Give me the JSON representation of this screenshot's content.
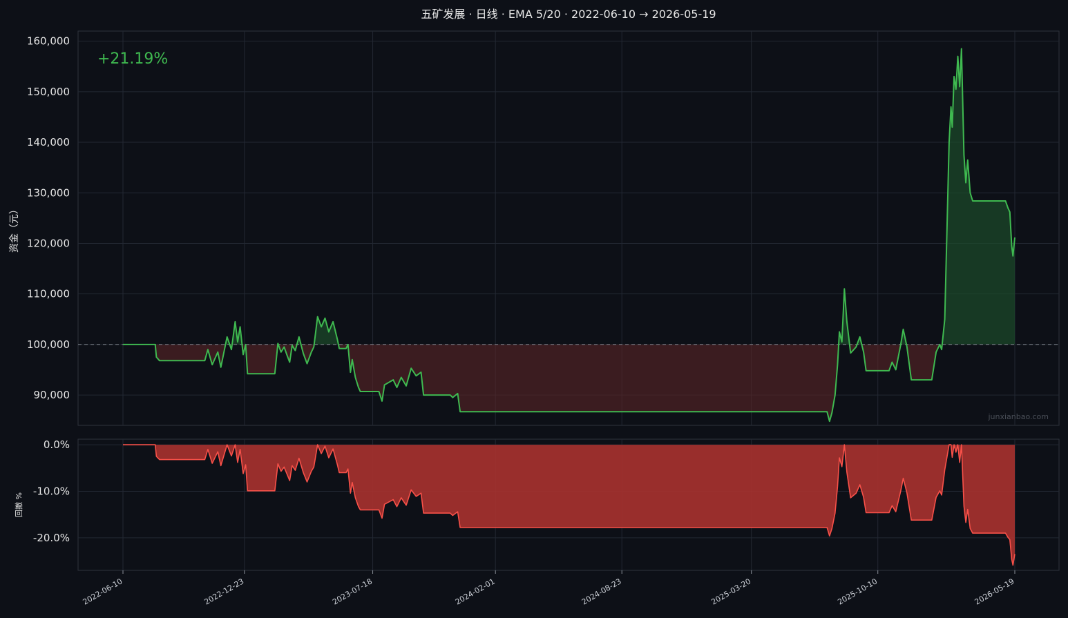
{
  "chart_data": [
    {
      "type": "line",
      "title": "五矿发展 · 日线 · EMA 5/20 · 2022-06-10 → 2026-05-19",
      "ylabel": "资金（元）",
      "ylim": [
        84000,
        162000
      ],
      "yticks": [
        "90,000",
        "100,000",
        "110,000",
        "120,000",
        "130,000",
        "140,000",
        "150,000",
        "160,000"
      ],
      "ytick_values": [
        90000,
        100000,
        110000,
        120000,
        130000,
        140000,
        150000,
        160000
      ],
      "baseline": 100000,
      "return_label": "+21.19%",
      "watermark": "junxianbao.com",
      "series": [
        {
          "color": "#3fb950",
          "points": [
            [
              "2022-06-10",
              100000
            ],
            [
              "2022-08-01",
              100000
            ],
            [
              "2022-08-03",
              97500
            ],
            [
              "2022-08-08",
              96800
            ],
            [
              "2022-10-20",
              96800
            ],
            [
              "2022-10-25",
              99000
            ],
            [
              "2022-11-01",
              96000
            ],
            [
              "2022-11-10",
              98500
            ],
            [
              "2022-11-15",
              95500
            ],
            [
              "2022-11-25",
              101500
            ],
            [
              "2022-12-02",
              99000
            ],
            [
              "2022-12-08",
              104500
            ],
            [
              "2022-12-12",
              100500
            ],
            [
              "2022-12-16",
              103500
            ],
            [
              "2022-12-21",
              98000
            ],
            [
              "2022-12-25",
              100000
            ],
            [
              "2022-12-28",
              94200
            ],
            [
              "2023-02-10",
              94200
            ],
            [
              "2023-02-15",
              100200
            ],
            [
              "2023-02-20",
              98500
            ],
            [
              "2023-02-25",
              99500
            ],
            [
              "2023-03-02",
              97800
            ],
            [
              "2023-03-06",
              96500
            ],
            [
              "2023-03-10",
              99800
            ],
            [
              "2023-03-15",
              98800
            ],
            [
              "2023-03-21",
              101500
            ],
            [
              "2023-03-28",
              98200
            ],
            [
              "2023-04-03",
              96200
            ],
            [
              "2023-04-10",
              98500
            ],
            [
              "2023-04-14",
              99500
            ],
            [
              "2023-04-20",
              105500
            ],
            [
              "2023-04-26",
              103500
            ],
            [
              "2023-05-02",
              105200
            ],
            [
              "2023-05-08",
              102500
            ],
            [
              "2023-05-15",
              104500
            ],
            [
              "2023-05-22",
              101000
            ],
            [
              "2023-05-25",
              99200
            ],
            [
              "2023-06-05",
              99200
            ],
            [
              "2023-06-08",
              100000
            ],
            [
              "2023-06-12",
              94500
            ],
            [
              "2023-06-15",
              97000
            ],
            [
              "2023-06-20",
              93500
            ],
            [
              "2023-06-25",
              91500
            ],
            [
              "2023-06-28",
              90700
            ],
            [
              "2023-07-28",
              90700
            ],
            [
              "2023-08-02",
              88800
            ],
            [
              "2023-08-06",
              92000
            ],
            [
              "2023-08-20",
              93000
            ],
            [
              "2023-08-26",
              91500
            ],
            [
              "2023-09-02",
              93500
            ],
            [
              "2023-09-10",
              91800
            ],
            [
              "2023-09-18",
              95300
            ],
            [
              "2023-09-26",
              93800
            ],
            [
              "2023-10-04",
              94500
            ],
            [
              "2023-10-08",
              90000
            ],
            [
              "2023-11-20",
              90000
            ],
            [
              "2023-11-24",
              89500
            ],
            [
              "2023-12-02",
              90300
            ],
            [
              "2023-12-06",
              86700
            ],
            [
              "2025-07-20",
              86700
            ],
            [
              "2025-07-24",
              84800
            ],
            [
              "2025-07-28",
              86500
            ],
            [
              "2025-08-02",
              90000
            ],
            [
              "2025-08-06",
              96000
            ],
            [
              "2025-08-09",
              102500
            ],
            [
              "2025-08-13",
              100500
            ],
            [
              "2025-08-17",
              111000
            ],
            [
              "2025-08-21",
              104500
            ],
            [
              "2025-08-27",
              98300
            ],
            [
              "2025-09-05",
              99500
            ],
            [
              "2025-09-11",
              101500
            ],
            [
              "2025-09-17",
              98500
            ],
            [
              "2025-09-21",
              94800
            ],
            [
              "2025-10-28",
              94800
            ],
            [
              "2025-11-02",
              96500
            ],
            [
              "2025-11-08",
              95000
            ],
            [
              "2025-11-16",
              100000
            ],
            [
              "2025-11-20",
              103000
            ],
            [
              "2025-11-26",
              99500
            ],
            [
              "2025-12-03",
              93000
            ],
            [
              "2026-01-05",
              93000
            ],
            [
              "2026-01-12",
              98500
            ],
            [
              "2026-01-18",
              100000
            ],
            [
              "2026-01-21",
              99000
            ],
            [
              "2026-01-26",
              105000
            ],
            [
              "2026-02-02",
              140000
            ],
            [
              "2026-02-05",
              147000
            ],
            [
              "2026-02-07",
              143000
            ],
            [
              "2026-02-10",
              153000
            ],
            [
              "2026-02-13",
              150500
            ],
            [
              "2026-02-16",
              157000
            ],
            [
              "2026-02-19",
              151000
            ],
            [
              "2026-02-22",
              158500
            ],
            [
              "2026-02-26",
              137500
            ],
            [
              "2026-03-01",
              132000
            ],
            [
              "2026-03-04",
              136500
            ],
            [
              "2026-03-08",
              130000
            ],
            [
              "2026-03-12",
              128400
            ],
            [
              "2026-05-04",
              128400
            ],
            [
              "2026-05-08",
              127000
            ],
            [
              "2026-05-11",
              126200
            ],
            [
              "2026-05-14",
              119500
            ],
            [
              "2026-05-16",
              117500
            ],
            [
              "2026-05-19",
              121190
            ]
          ]
        }
      ],
      "xticks": [
        "2022-06-10",
        "2022-12-23",
        "2023-07-18",
        "2024-02-01",
        "2024-08-23",
        "2025-03-20",
        "2025-10-10",
        "2026-05-19"
      ]
    },
    {
      "type": "area",
      "ylabel": "回撤 %",
      "ylim": [
        -27,
        1.2
      ],
      "yticks": [
        "0.0%",
        "-10.0%",
        "-20.0%"
      ],
      "ytick_values": [
        0,
        -10,
        -20
      ],
      "series": [
        {
          "color": "#f85149",
          "points": [
            [
              "2022-06-10",
              0
            ],
            [
              "2022-08-01",
              0
            ],
            [
              "2022-08-03",
              -2.5
            ],
            [
              "2022-08-08",
              -3.2
            ],
            [
              "2022-10-20",
              -3.2
            ],
            [
              "2022-10-25",
              -1.0
            ],
            [
              "2022-11-01",
              -4.0
            ],
            [
              "2022-11-10",
              -1.5
            ],
            [
              "2022-11-15",
              -4.5
            ],
            [
              "2022-11-25",
              0
            ],
            [
              "2022-12-02",
              -2.4
            ],
            [
              "2022-12-08",
              0
            ],
            [
              "2022-12-12",
              -3.8
            ],
            [
              "2022-12-16",
              -1.0
            ],
            [
              "2022-12-21",
              -6.2
            ],
            [
              "2022-12-25",
              -4.3
            ],
            [
              "2022-12-28",
              -9.9
            ],
            [
              "2023-02-10",
              -9.9
            ],
            [
              "2023-02-15",
              -4.1
            ],
            [
              "2023-02-20",
              -5.7
            ],
            [
              "2023-02-25",
              -4.8
            ],
            [
              "2023-03-02",
              -6.4
            ],
            [
              "2023-03-06",
              -7.7
            ],
            [
              "2023-03-10",
              -4.5
            ],
            [
              "2023-03-15",
              -5.5
            ],
            [
              "2023-03-21",
              -2.9
            ],
            [
              "2023-03-28",
              -6.0
            ],
            [
              "2023-04-03",
              -8.0
            ],
            [
              "2023-04-10",
              -5.7
            ],
            [
              "2023-04-14",
              -4.8
            ],
            [
              "2023-04-20",
              0
            ],
            [
              "2023-04-26",
              -1.9
            ],
            [
              "2023-05-02",
              -0.3
            ],
            [
              "2023-05-08",
              -2.8
            ],
            [
              "2023-05-15",
              -0.9
            ],
            [
              "2023-05-22",
              -4.3
            ],
            [
              "2023-05-25",
              -6.0
            ],
            [
              "2023-06-05",
              -6.0
            ],
            [
              "2023-06-08",
              -5.2
            ],
            [
              "2023-06-12",
              -10.4
            ],
            [
              "2023-06-15",
              -8.1
            ],
            [
              "2023-06-20",
              -11.4
            ],
            [
              "2023-06-25",
              -13.3
            ],
            [
              "2023-06-28",
              -14.0
            ],
            [
              "2023-07-28",
              -14.0
            ],
            [
              "2023-08-02",
              -15.8
            ],
            [
              "2023-08-06",
              -12.8
            ],
            [
              "2023-08-20",
              -11.8
            ],
            [
              "2023-08-26",
              -13.3
            ],
            [
              "2023-09-02",
              -11.4
            ],
            [
              "2023-09-10",
              -13.0
            ],
            [
              "2023-09-18",
              -9.7
            ],
            [
              "2023-09-26",
              -11.1
            ],
            [
              "2023-10-04",
              -10.4
            ],
            [
              "2023-10-08",
              -14.7
            ],
            [
              "2023-11-20",
              -14.7
            ],
            [
              "2023-11-24",
              -15.2
            ],
            [
              "2023-12-02",
              -14.4
            ],
            [
              "2023-12-06",
              -17.8
            ],
            [
              "2025-07-20",
              -17.8
            ],
            [
              "2025-07-24",
              -19.6
            ],
            [
              "2025-07-28",
              -18.0
            ],
            [
              "2025-08-02",
              -14.7
            ],
            [
              "2025-08-06",
              -9.0
            ],
            [
              "2025-08-09",
              -2.8
            ],
            [
              "2025-08-13",
              -4.7
            ],
            [
              "2025-08-17",
              0
            ],
            [
              "2025-08-21",
              -5.9
            ],
            [
              "2025-08-27",
              -11.4
            ],
            [
              "2025-09-05",
              -10.4
            ],
            [
              "2025-09-11",
              -8.6
            ],
            [
              "2025-09-17",
              -11.3
            ],
            [
              "2025-09-21",
              -14.6
            ],
            [
              "2025-10-28",
              -14.6
            ],
            [
              "2025-11-02",
              -13.1
            ],
            [
              "2025-11-08",
              -14.4
            ],
            [
              "2025-11-16",
              -9.9
            ],
            [
              "2025-11-20",
              -7.2
            ],
            [
              "2025-11-26",
              -10.4
            ],
            [
              "2025-12-03",
              -16.2
            ],
            [
              "2026-01-05",
              -16.2
            ],
            [
              "2026-01-12",
              -11.3
            ],
            [
              "2026-01-18",
              -9.9
            ],
            [
              "2026-01-21",
              -10.8
            ],
            [
              "2026-01-26",
              -5.4
            ],
            [
              "2026-02-02",
              0
            ],
            [
              "2026-02-05",
              0
            ],
            [
              "2026-02-07",
              -2.7
            ],
            [
              "2026-02-10",
              0
            ],
            [
              "2026-02-13",
              -1.6
            ],
            [
              "2026-02-16",
              0
            ],
            [
              "2026-02-19",
              -3.8
            ],
            [
              "2026-02-22",
              0
            ],
            [
              "2026-02-26",
              -13.2
            ],
            [
              "2026-03-01",
              -16.7
            ],
            [
              "2026-03-04",
              -13.9
            ],
            [
              "2026-03-08",
              -18.0
            ],
            [
              "2026-03-12",
              -19.0
            ],
            [
              "2026-05-04",
              -19.0
            ],
            [
              "2026-05-08",
              -19.9
            ],
            [
              "2026-05-11",
              -20.4
            ],
            [
              "2026-05-14",
              -24.6
            ],
            [
              "2026-05-16",
              -25.9
            ],
            [
              "2026-05-19",
              -23.5
            ]
          ]
        }
      ]
    }
  ],
  "colors": {
    "background": "#0d1017",
    "equity_line": "#3fb950",
    "drawdown": "#f85149",
    "grid": "#232833",
    "frame": "#2e333c"
  }
}
